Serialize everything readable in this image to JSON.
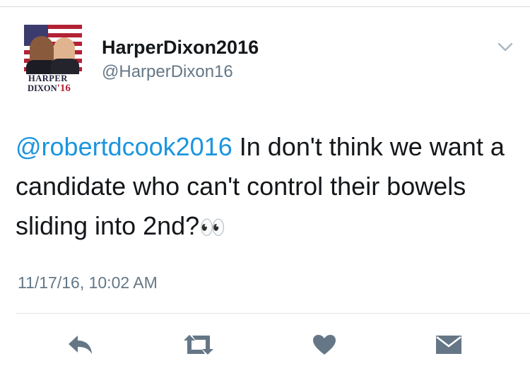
{
  "user": {
    "display_name": "HarperDixon2016",
    "handle": "@HarperDixon16",
    "avatar": {
      "logo_line1": "HARPER",
      "logo_line2": "DIXON",
      "logo_year": "'16"
    }
  },
  "tweet": {
    "mention": "@robertdcook2016",
    "text": " In don't think we want a candidate who can't control their bowels sliding into 2nd?",
    "emoji": "👀",
    "timestamp": "11/17/16, 10:02 AM"
  },
  "actions": [
    {
      "name": "reply",
      "icon": "reply-icon"
    },
    {
      "name": "retweet",
      "icon": "retweet-icon"
    },
    {
      "name": "like",
      "icon": "heart-icon"
    },
    {
      "name": "direct-message",
      "icon": "envelope-icon"
    }
  ],
  "colors": {
    "link": "#1b95e0",
    "secondary_text": "#657786",
    "icon": "#657786",
    "text": "#14171a"
  }
}
